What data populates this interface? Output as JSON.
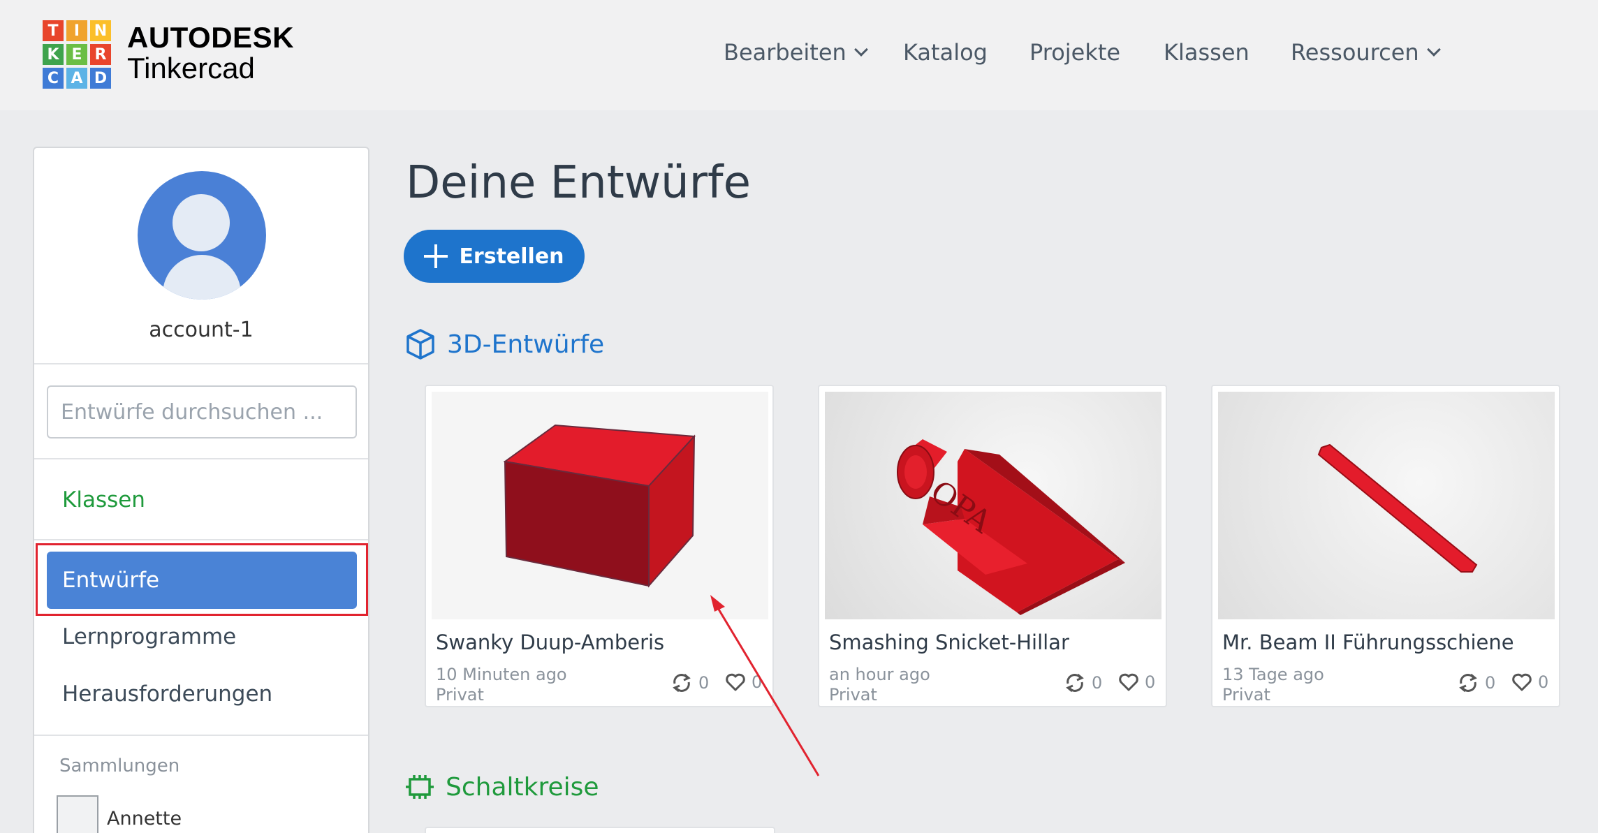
{
  "header": {
    "logo_letters": [
      "T",
      "I",
      "N",
      "K",
      "E",
      "R",
      "C",
      "A",
      "D"
    ],
    "logo_colors": [
      "#e8452c",
      "#f0a32e",
      "#fbbf2a",
      "#3fa34d",
      "#6bbe45",
      "#e8452c",
      "#3f7bd6",
      "#5cb3e6",
      "#3f7bd6"
    ],
    "brand_top": "AUTODESK",
    "brand_bottom": "Tinkercad",
    "nav": {
      "bearbeiten": "Bearbeiten",
      "katalog": "Katalog",
      "projekte": "Projekte",
      "klassen": "Klassen",
      "ressourcen": "Ressourcen"
    }
  },
  "sidebar": {
    "username": "account-1",
    "search_placeholder": "Entwürfe durchsuchen ...",
    "klassen": "Klassen",
    "entwuerfe": "Entwürfe",
    "lernprogramme": "Lernprogramme",
    "herausforderungen": "Herausforderungen",
    "sammlungen": "Sammlungen",
    "collection_name": "Annette"
  },
  "main": {
    "title": "Deine Entwürfe",
    "create_label": "Erstellen",
    "section_3d": "3D-Entwürfe",
    "section_circuits": "Schaltkreise",
    "cards": [
      {
        "title": "Swanky Duup-Amberis",
        "time": "10 Minuten ago",
        "privacy": "Privat",
        "remixes": "0",
        "likes": "0"
      },
      {
        "title": "Smashing Snicket-Hillar",
        "time": "an hour ago",
        "privacy": "Privat",
        "remixes": "0",
        "likes": "0"
      },
      {
        "title": "Mr. Beam II Führungsschiene",
        "time": "13 Tage ago",
        "privacy": "Privat",
        "remixes": "0",
        "likes": "0"
      }
    ]
  },
  "colors": {
    "accent_blue": "#1e74cc",
    "active_item": "#4a83d6",
    "green": "#1f9a3c",
    "annotation_red": "#e1232f"
  }
}
